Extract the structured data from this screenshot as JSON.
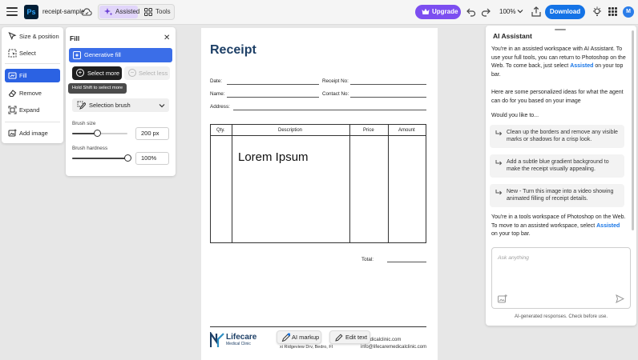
{
  "topbar": {
    "filename": "receipt-sample",
    "mode_assisted": "Assisted",
    "mode_tools": "Tools",
    "upgrade_label": "Upgrade",
    "zoom": "100%",
    "download_label": "Download",
    "avatar_initial": "M"
  },
  "tools": {
    "items": [
      {
        "label": "Size & position"
      },
      {
        "label": "Select"
      },
      {
        "label": "Fill"
      },
      {
        "label": "Remove"
      },
      {
        "label": "Expand"
      },
      {
        "label": "Add image"
      }
    ]
  },
  "fill_panel": {
    "title": "Fill",
    "generative_fill": "Generative fill",
    "select_more": "Select more",
    "select_less": "Select less",
    "tooltip": "Hold Shift to select more",
    "selection_brush": "Selection brush",
    "brush_size_label": "Brush size",
    "brush_size_value": "200 px",
    "brush_size_level": 0.45,
    "brush_hardness_label": "Brush hardness",
    "brush_hardness_value": "100%",
    "brush_hardness_level": 1.0
  },
  "receipt": {
    "title": "Receipt",
    "date_label": "Date:",
    "receipt_no_label": "Receipt No:",
    "name_label": "Name:",
    "contact_no_label": "Contact No:",
    "address_label": "Address:",
    "columns": [
      "Qty.",
      "Description",
      "Price",
      "Amount"
    ],
    "body_text": "Lorem Ipsum",
    "total_label": "Total:",
    "brand_name": "Lifecare",
    "brand_sub": "Medical Clinic",
    "address_fragment": "xi Ridgeview Drv, Bedro, FI",
    "email_line1": "emedicalclinic.com",
    "email_line2": "info@lifecaremedicalclinic.com"
  },
  "canvas_actions": {
    "ai_markup": "AI markup",
    "edit_text": "Edit text"
  },
  "assistant": {
    "title": "AI Assistant",
    "intro_before": "You're in an assisted workspace with AI Assistant. To use your full tools, you can return to Photoshop on the Web. To come back, just select ",
    "intro_link": "Assisted",
    "intro_after": " on your top bar.",
    "ideas": "Here are some personalized ideas for what the agent can do for you based on your image",
    "would_you_like": "Would you like to...",
    "suggestions": [
      "Clean up the borders and remove any visible marks or shadows for a crisp look.",
      "Add a subtle blue gradient background to make the receipt visually appealing.",
      "New - Turn this image into a video showing animated filling of receipt details."
    ],
    "tools_before": "You're in a tools workspace of Photoshop on the Web. To move to an assisted workspace, select ",
    "tools_link": "Assisted",
    "tools_after": " on your top bar.",
    "ask_placeholder": "Ask anything",
    "disclaimer": "AI-generated responses. Check before use."
  },
  "colors": {
    "accent_blue": "#1473e6",
    "fill_active": "#2b62e3",
    "upgrade_purple": "#7c4ef0",
    "assisted_bg": "#e1d5fa",
    "receipt_navy": "#1d3f66"
  }
}
